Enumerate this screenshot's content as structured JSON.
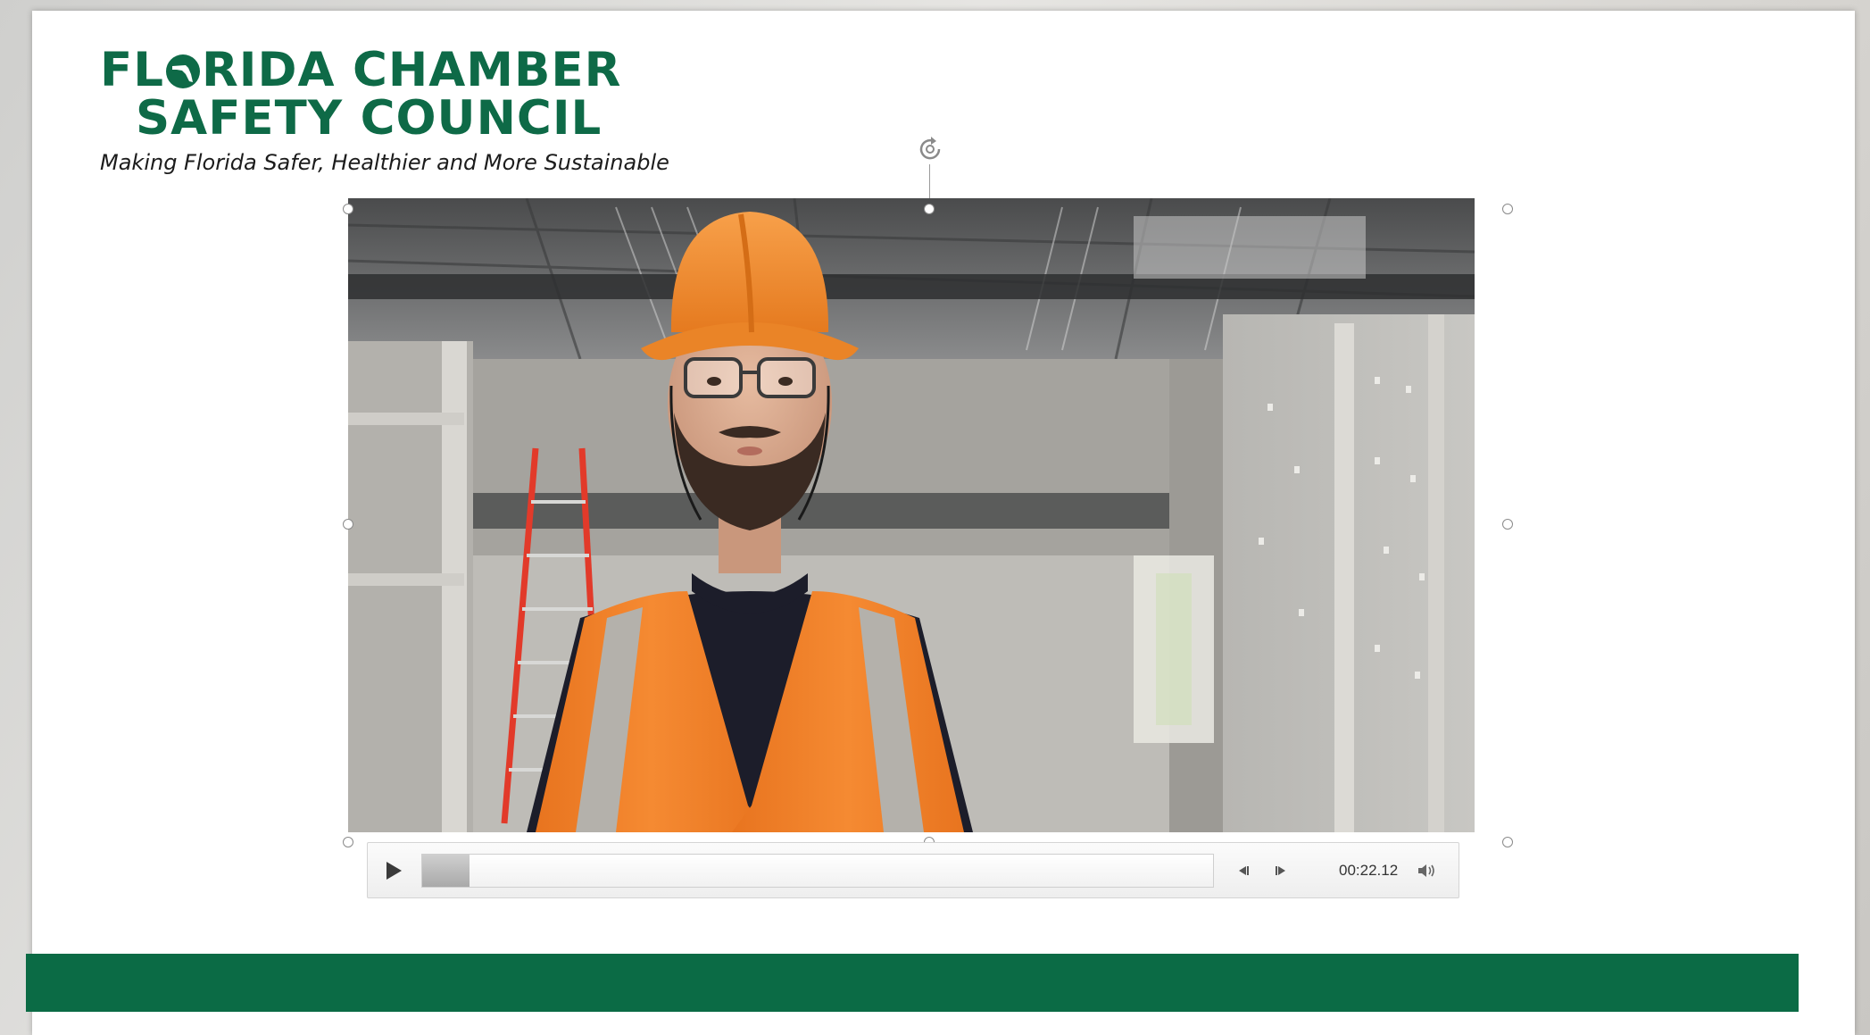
{
  "logo": {
    "line1_before": "FL",
    "line1_after": "RIDA CHAMBER",
    "line2": "SAFETY COUNCIL",
    "tagline": "Making Florida Safer, Healthier and More Sustainable",
    "brand_color": "#0e6a47"
  },
  "video": {
    "poster_description": "construction-worker-in-hard-hat-and-safety-vest",
    "selected": true
  },
  "media_controls": {
    "play_icon": "play-icon",
    "progress_fraction": 0.06,
    "step_back_icon": "step-back-icon",
    "step_forward_icon": "step-forward-icon",
    "time": "00:22.12",
    "volume_icon": "volume-icon"
  },
  "footer": {
    "bar_color": "#0b6b45"
  }
}
